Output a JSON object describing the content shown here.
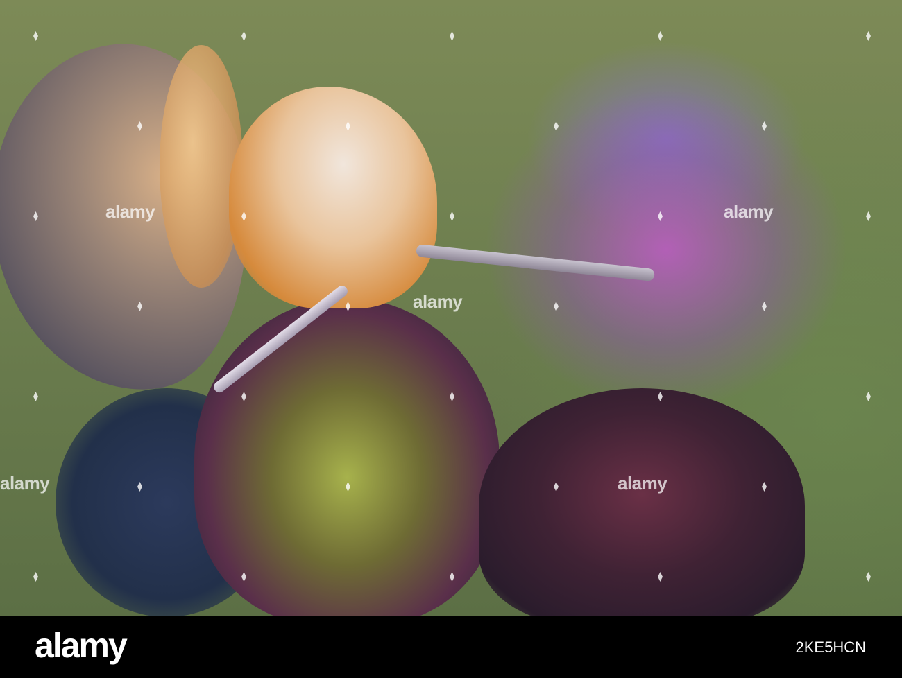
{
  "watermark": {
    "text": "alamy",
    "positions_label": [
      "alamy",
      "alamy",
      "alamy",
      "alamy",
      "alamy",
      "alamy",
      "alamy"
    ]
  },
  "footer": {
    "logo": "alamy",
    "image_id": "2KE5HCN"
  },
  "colors": {
    "background": "#6f8050",
    "flower_bokeh": "#b45ac8",
    "footer": "#000000"
  }
}
